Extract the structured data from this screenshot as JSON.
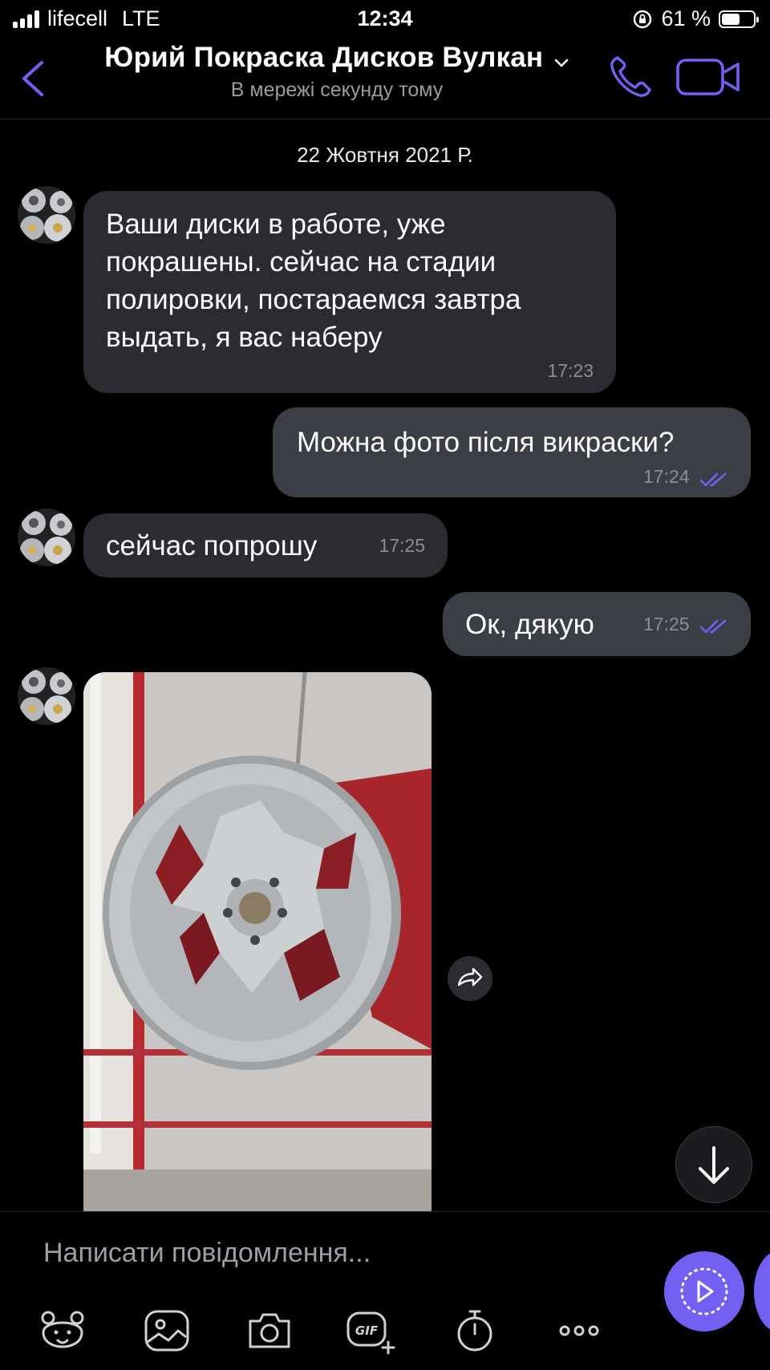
{
  "status_bar": {
    "carrier": "lifecell",
    "network": "LTE",
    "time": "12:34",
    "battery_text": "61 %",
    "battery_level": 0.61
  },
  "header": {
    "title": "Юрий Покраска Дисков Вулкан",
    "subtitle": "В мережі секунду тому"
  },
  "chat": {
    "date_separator": "22 Жовтня 2021 Р.",
    "messages": [
      {
        "direction": "in",
        "text": "Ваши диски в работе, уже покрашены. сейчас на стадии полировки, постараемся завтра выдать, я вас наберу",
        "time": "17:23"
      },
      {
        "direction": "out",
        "text": "Можна фото після викраски?",
        "time": "17:24",
        "status": "read"
      },
      {
        "direction": "in",
        "text": "сейчас попрошу",
        "time": "17:25"
      },
      {
        "direction": "out",
        "text": "Ок, дякую",
        "time": "17:25",
        "status": "read"
      },
      {
        "direction": "in",
        "type": "photo"
      }
    ]
  },
  "composer": {
    "placeholder": "Написати повідомлення...",
    "toolbar": [
      "sticker-icon",
      "gallery-icon",
      "camera-icon",
      "gif-icon",
      "timer-icon",
      "more-icon"
    ]
  },
  "colors": {
    "accent": "#7360f2",
    "incoming_bubble": "#2b2c31",
    "outgoing_bubble": "#3c3e46",
    "background": "#000000"
  }
}
